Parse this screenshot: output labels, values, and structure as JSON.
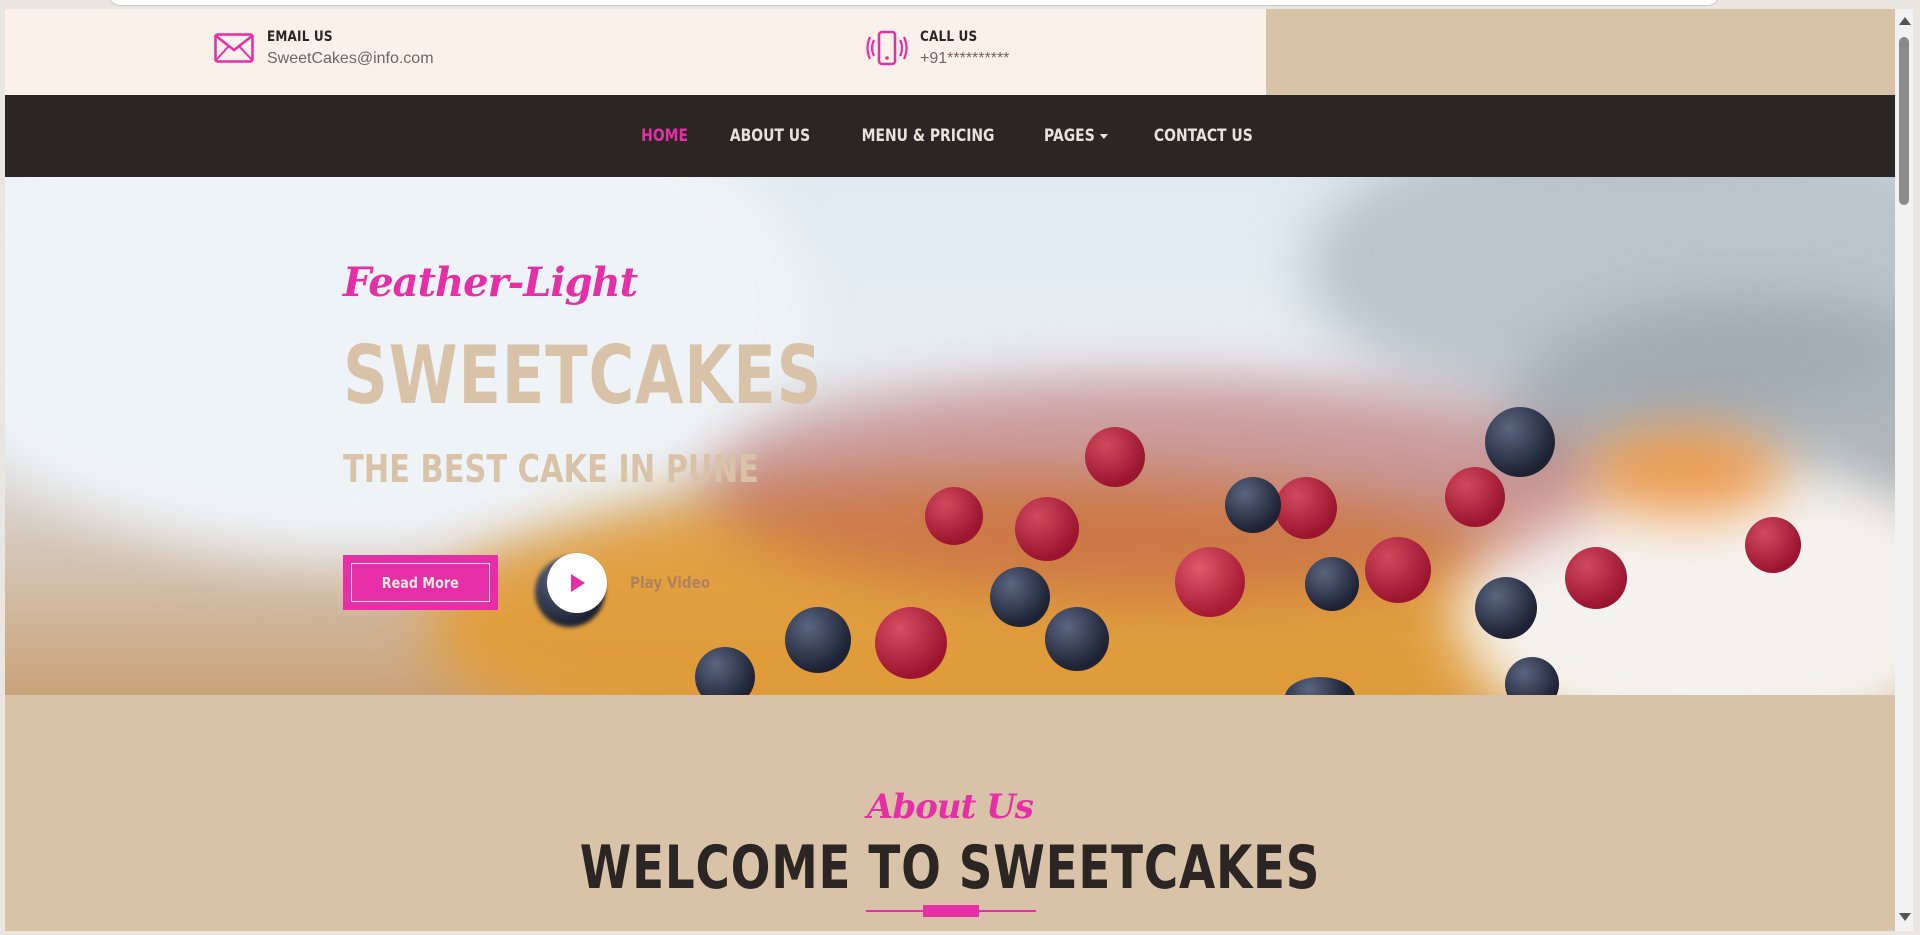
{
  "topbar": {
    "email": {
      "icon": "envelope-icon",
      "title": "EMAIL US",
      "value": "SweetCakes@info.com"
    },
    "call": {
      "icon": "mobile-phone-icon",
      "title": "CALL US",
      "value": "+91**********"
    }
  },
  "nav": {
    "items": [
      {
        "label": "HOME",
        "active": true
      },
      {
        "label": "ABOUT US"
      },
      {
        "label": "MENU & PRICING"
      },
      {
        "label": "PAGES",
        "dropdown": true
      },
      {
        "label": "CONTACT US"
      }
    ]
  },
  "hero": {
    "script_text": "Feather-Light",
    "title": "SWEETCAKES",
    "subtitle": "THE BEST CAKE IN PUNE",
    "read_more_label": "Read More",
    "play_icon": "play-icon",
    "play_label": "Play Video"
  },
  "about": {
    "script_text": "About Us",
    "title": "WELCOME TO SWEETCAKES"
  },
  "colors": {
    "accent": "#e62fa6",
    "dark": "#2b2623",
    "beige": "#d8c3a9",
    "cream": "#faf1ea"
  }
}
